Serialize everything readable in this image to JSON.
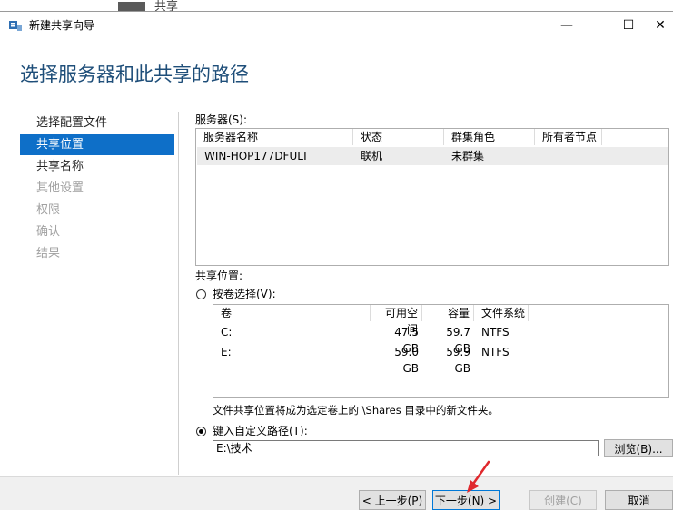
{
  "background_window": {
    "title_fragment": "共享"
  },
  "window": {
    "title": "新建共享向导",
    "controls": {
      "minimize": "—",
      "maximize": "☐",
      "close": "✕"
    }
  },
  "page_heading": "选择服务器和此共享的路径",
  "nav": {
    "items": [
      {
        "label": "选择配置文件",
        "state": "done"
      },
      {
        "label": "共享位置",
        "state": "active"
      },
      {
        "label": "共享名称",
        "state": "done"
      },
      {
        "label": "其他设置",
        "state": "disabled"
      },
      {
        "label": "权限",
        "state": "disabled"
      },
      {
        "label": "确认",
        "state": "disabled"
      },
      {
        "label": "结果",
        "state": "disabled"
      }
    ]
  },
  "servers": {
    "label": "服务器(S):",
    "columns": [
      "服务器名称",
      "状态",
      "群集角色",
      "所有者节点"
    ],
    "rows": [
      {
        "name": "WIN-HOP177DFULT",
        "status": "联机",
        "cluster_role": "未群集",
        "owner_node": ""
      }
    ]
  },
  "share_location": {
    "label": "共享位置:",
    "by_volume": {
      "label": "按卷选择(V):",
      "selected": false,
      "columns": [
        "卷",
        "可用空间",
        "容量",
        "文件系统"
      ],
      "rows": [
        {
          "volume": "C:",
          "free": "47.5 GB",
          "capacity": "59.7 GB",
          "fs": "NTFS"
        },
        {
          "volume": "E:",
          "free": "59.0 GB",
          "capacity": "59.9 GB",
          "fs": "NTFS"
        }
      ],
      "note": "文件共享位置将成为选定卷上的 \\Shares 目录中的新文件夹。"
    },
    "custom_path": {
      "label": "键入自定义路径(T):",
      "selected": true,
      "value": "E:\\技术",
      "browse_label": "浏览(B)..."
    }
  },
  "buttons": {
    "prev": "< 上一步(P)",
    "next": "下一步(N) >",
    "create": "创建(C)",
    "cancel": "取消"
  },
  "colors": {
    "accent": "#0e6fc8",
    "heading": "#1e4e79",
    "annotation_arrow": "#e0282d"
  }
}
